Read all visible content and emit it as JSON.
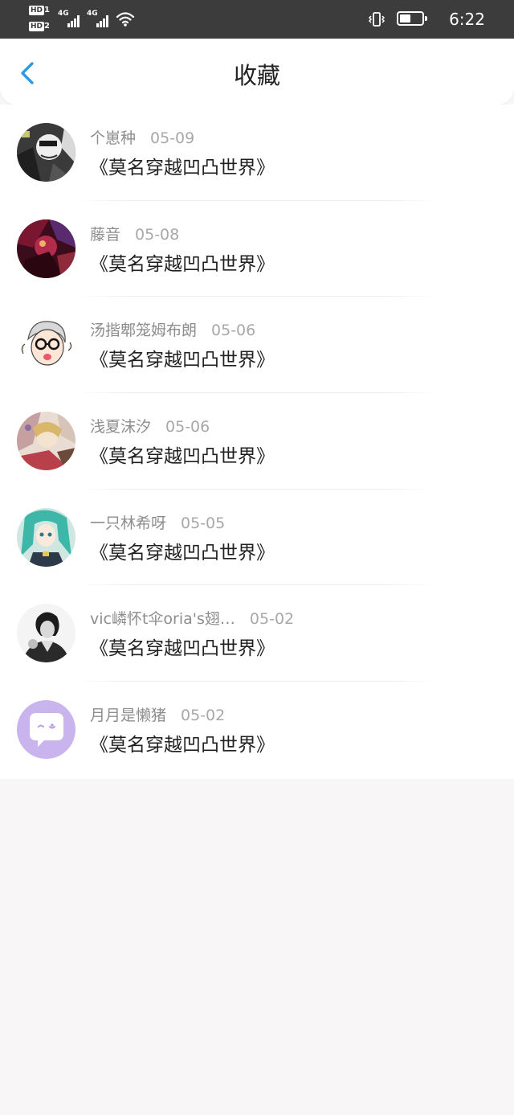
{
  "status_bar": {
    "sim1": "HD",
    "sim1_num": "1",
    "sim2": "HD",
    "sim2_num": "2",
    "net1": "4G",
    "net2": "4G",
    "time": "6:22",
    "icons": [
      "signal-icon",
      "wifi-icon",
      "vibrate-icon",
      "battery-icon"
    ]
  },
  "header": {
    "title": "收藏",
    "back_icon": "chevron-left-icon",
    "accent_color": "#2b9be8"
  },
  "favorites": [
    {
      "user": "个崽种",
      "date": "05-09",
      "book": "《莫名穿越凹凸世界》"
    },
    {
      "user": "藤音",
      "date": "05-08",
      "book": "《莫名穿越凹凸世界》"
    },
    {
      "user": "汤揩郫笼姆布朗",
      "date": "05-06",
      "book": "《莫名穿越凹凸世界》"
    },
    {
      "user": "浅夏沫汐",
      "date": "05-06",
      "book": "《莫名穿越凹凸世界》"
    },
    {
      "user": "一只林希呀",
      "date": "05-05",
      "book": "《莫名穿越凹凸世界》"
    },
    {
      "user": "vic嶙怀t伞oria's翅…",
      "date": "05-02",
      "book": "《莫名穿越凹凸世界》"
    },
    {
      "user": "月月是懒猪",
      "date": "05-02",
      "book": "《莫名穿越凹凸世界》"
    }
  ]
}
